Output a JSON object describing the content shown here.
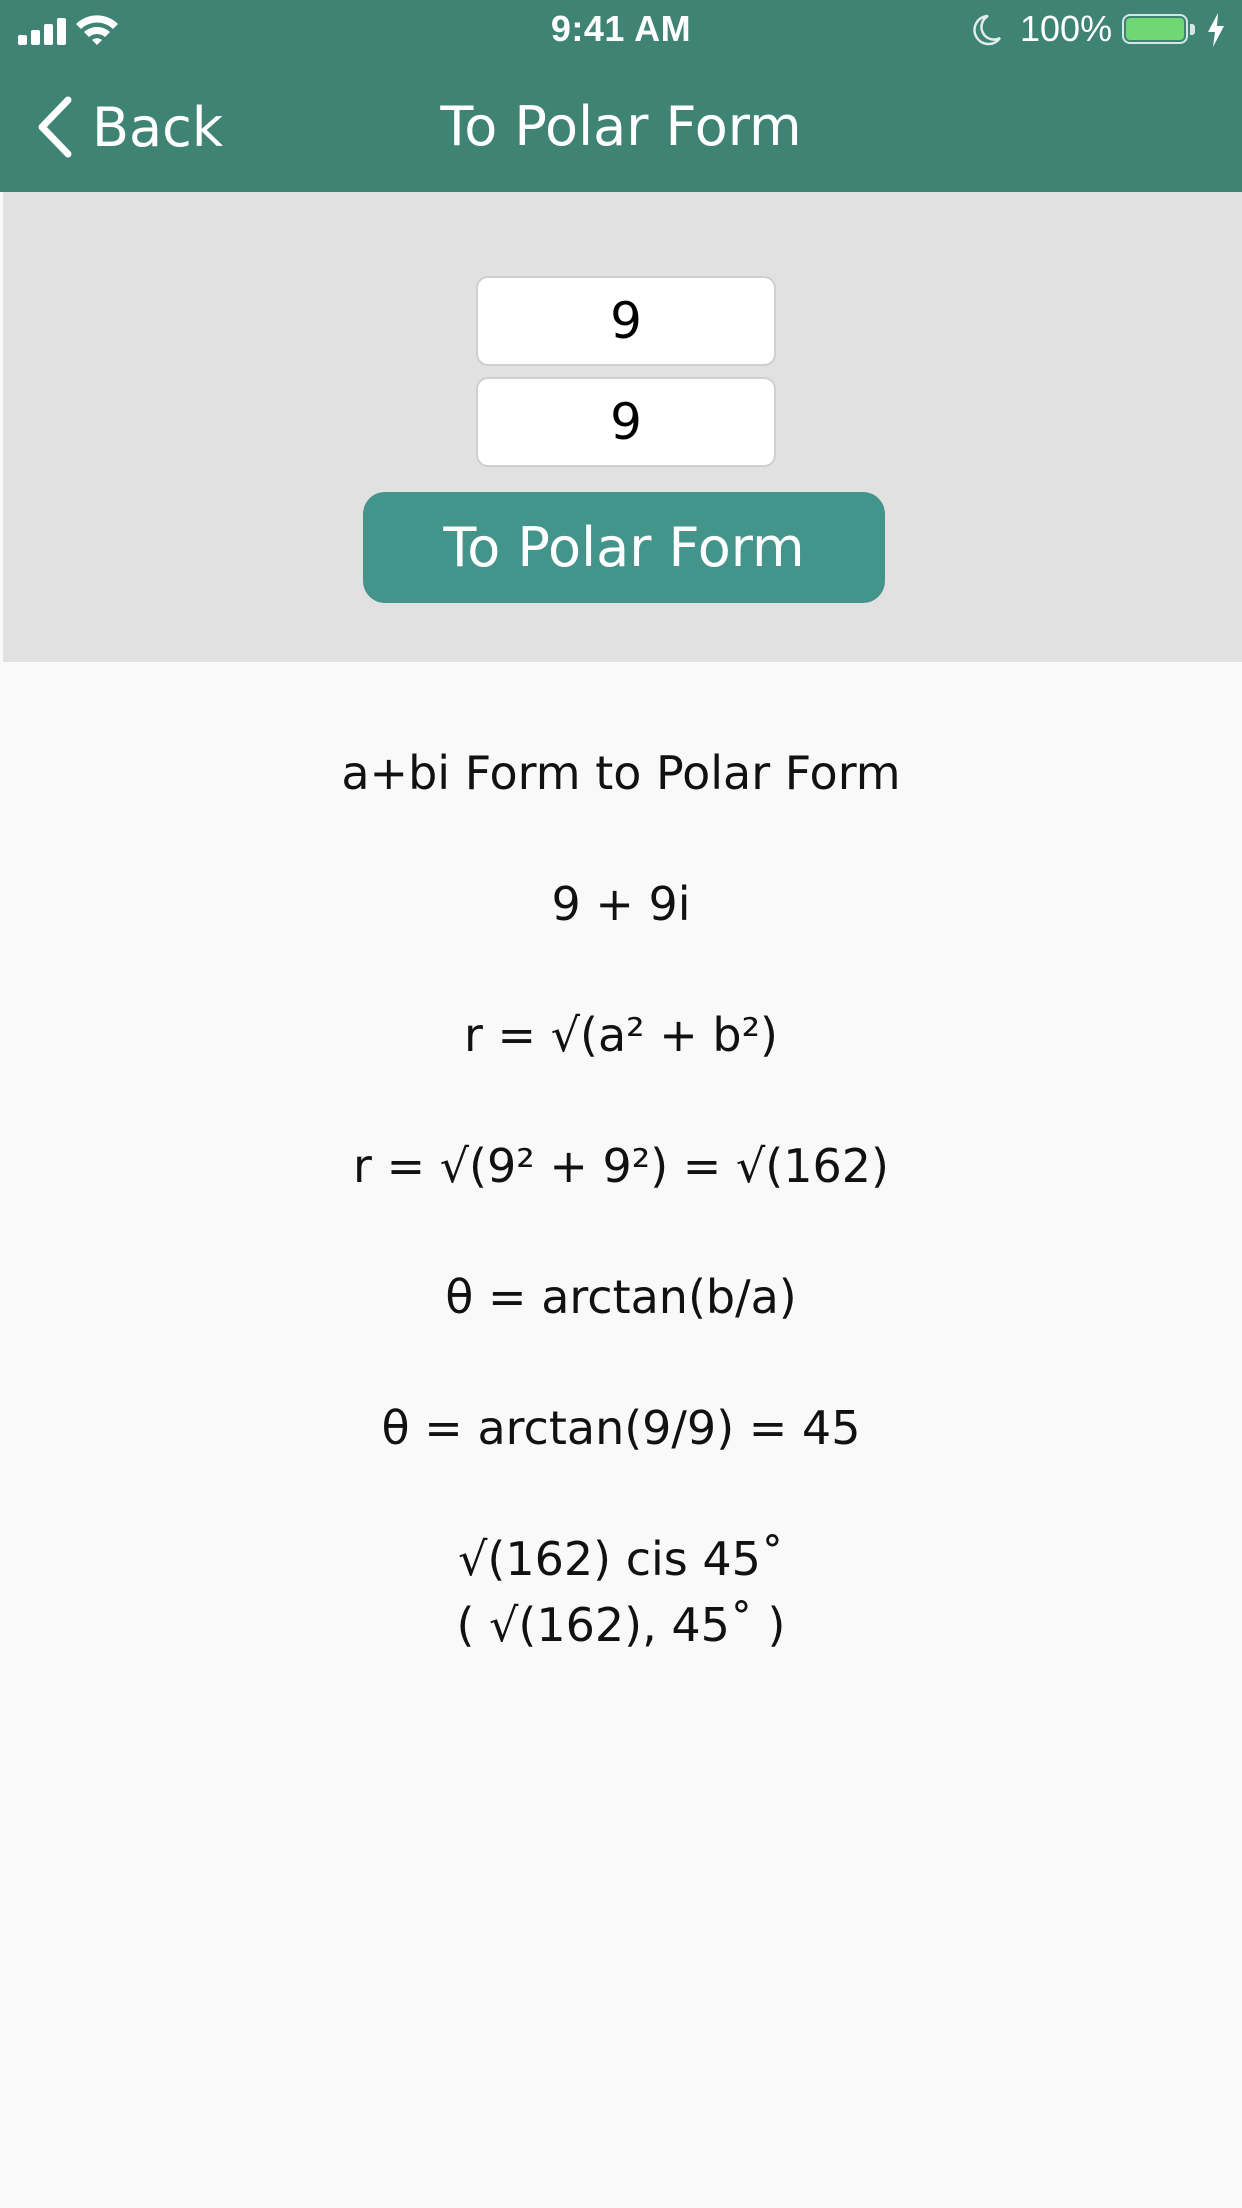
{
  "status_bar": {
    "time": "9:41 AM",
    "battery_percent_label": "100%",
    "battery_level": 1.0,
    "icons": [
      "signal-icon",
      "wifi-icon",
      "moon-icon",
      "battery-icon",
      "charging-icon"
    ]
  },
  "nav": {
    "back_label": "Back",
    "title": "To Polar Form"
  },
  "inputs": {
    "real_value": "9",
    "imaginary_value": "9",
    "convert_label": "To Polar Form"
  },
  "result": {
    "lines": [
      "a+bi Form to Polar Form",
      "9 + 9i",
      "r = √(a² + b²)",
      "r = √(9² + 9²) = √(162)",
      "θ = arctan(b/a)",
      "θ = arctan(9/9) = 45"
    ],
    "final_lines": [
      "√(162) cis 45˚",
      "( √(162), 45˚ )"
    ]
  },
  "colors": {
    "header": "#3e8374",
    "button": "#43948a",
    "panel": "#e1e1e1",
    "background": "#f9f9f9",
    "battery_fill": "#6fd872"
  }
}
